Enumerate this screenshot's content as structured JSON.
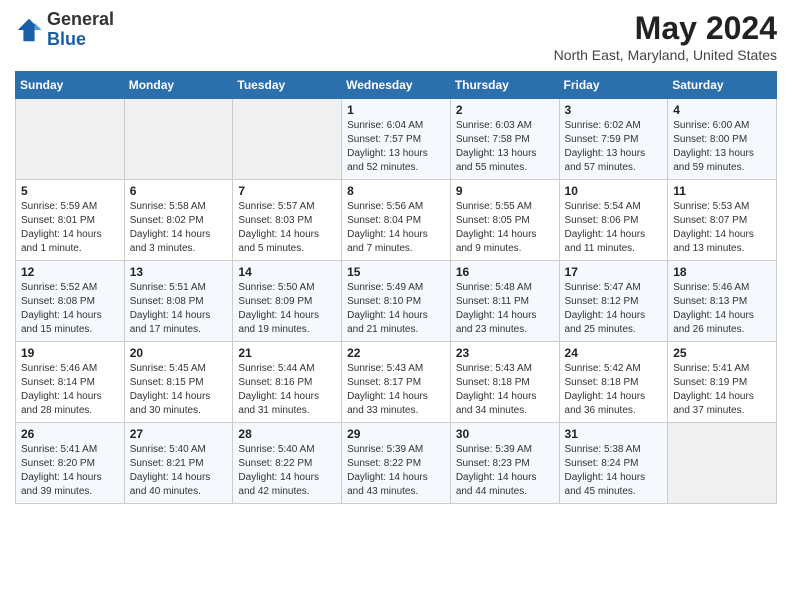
{
  "header": {
    "logo_general": "General",
    "logo_blue": "Blue",
    "month_year": "May 2024",
    "location": "North East, Maryland, United States"
  },
  "days_of_week": [
    "Sunday",
    "Monday",
    "Tuesday",
    "Wednesday",
    "Thursday",
    "Friday",
    "Saturday"
  ],
  "weeks": [
    [
      {
        "day": "",
        "info": ""
      },
      {
        "day": "",
        "info": ""
      },
      {
        "day": "",
        "info": ""
      },
      {
        "day": "1",
        "info": "Sunrise: 6:04 AM\nSunset: 7:57 PM\nDaylight: 13 hours\nand 52 minutes."
      },
      {
        "day": "2",
        "info": "Sunrise: 6:03 AM\nSunset: 7:58 PM\nDaylight: 13 hours\nand 55 minutes."
      },
      {
        "day": "3",
        "info": "Sunrise: 6:02 AM\nSunset: 7:59 PM\nDaylight: 13 hours\nand 57 minutes."
      },
      {
        "day": "4",
        "info": "Sunrise: 6:00 AM\nSunset: 8:00 PM\nDaylight: 13 hours\nand 59 minutes."
      }
    ],
    [
      {
        "day": "5",
        "info": "Sunrise: 5:59 AM\nSunset: 8:01 PM\nDaylight: 14 hours\nand 1 minute."
      },
      {
        "day": "6",
        "info": "Sunrise: 5:58 AM\nSunset: 8:02 PM\nDaylight: 14 hours\nand 3 minutes."
      },
      {
        "day": "7",
        "info": "Sunrise: 5:57 AM\nSunset: 8:03 PM\nDaylight: 14 hours\nand 5 minutes."
      },
      {
        "day": "8",
        "info": "Sunrise: 5:56 AM\nSunset: 8:04 PM\nDaylight: 14 hours\nand 7 minutes."
      },
      {
        "day": "9",
        "info": "Sunrise: 5:55 AM\nSunset: 8:05 PM\nDaylight: 14 hours\nand 9 minutes."
      },
      {
        "day": "10",
        "info": "Sunrise: 5:54 AM\nSunset: 8:06 PM\nDaylight: 14 hours\nand 11 minutes."
      },
      {
        "day": "11",
        "info": "Sunrise: 5:53 AM\nSunset: 8:07 PM\nDaylight: 14 hours\nand 13 minutes."
      }
    ],
    [
      {
        "day": "12",
        "info": "Sunrise: 5:52 AM\nSunset: 8:08 PM\nDaylight: 14 hours\nand 15 minutes."
      },
      {
        "day": "13",
        "info": "Sunrise: 5:51 AM\nSunset: 8:08 PM\nDaylight: 14 hours\nand 17 minutes."
      },
      {
        "day": "14",
        "info": "Sunrise: 5:50 AM\nSunset: 8:09 PM\nDaylight: 14 hours\nand 19 minutes."
      },
      {
        "day": "15",
        "info": "Sunrise: 5:49 AM\nSunset: 8:10 PM\nDaylight: 14 hours\nand 21 minutes."
      },
      {
        "day": "16",
        "info": "Sunrise: 5:48 AM\nSunset: 8:11 PM\nDaylight: 14 hours\nand 23 minutes."
      },
      {
        "day": "17",
        "info": "Sunrise: 5:47 AM\nSunset: 8:12 PM\nDaylight: 14 hours\nand 25 minutes."
      },
      {
        "day": "18",
        "info": "Sunrise: 5:46 AM\nSunset: 8:13 PM\nDaylight: 14 hours\nand 26 minutes."
      }
    ],
    [
      {
        "day": "19",
        "info": "Sunrise: 5:46 AM\nSunset: 8:14 PM\nDaylight: 14 hours\nand 28 minutes."
      },
      {
        "day": "20",
        "info": "Sunrise: 5:45 AM\nSunset: 8:15 PM\nDaylight: 14 hours\nand 30 minutes."
      },
      {
        "day": "21",
        "info": "Sunrise: 5:44 AM\nSunset: 8:16 PM\nDaylight: 14 hours\nand 31 minutes."
      },
      {
        "day": "22",
        "info": "Sunrise: 5:43 AM\nSunset: 8:17 PM\nDaylight: 14 hours\nand 33 minutes."
      },
      {
        "day": "23",
        "info": "Sunrise: 5:43 AM\nSunset: 8:18 PM\nDaylight: 14 hours\nand 34 minutes."
      },
      {
        "day": "24",
        "info": "Sunrise: 5:42 AM\nSunset: 8:18 PM\nDaylight: 14 hours\nand 36 minutes."
      },
      {
        "day": "25",
        "info": "Sunrise: 5:41 AM\nSunset: 8:19 PM\nDaylight: 14 hours\nand 37 minutes."
      }
    ],
    [
      {
        "day": "26",
        "info": "Sunrise: 5:41 AM\nSunset: 8:20 PM\nDaylight: 14 hours\nand 39 minutes."
      },
      {
        "day": "27",
        "info": "Sunrise: 5:40 AM\nSunset: 8:21 PM\nDaylight: 14 hours\nand 40 minutes."
      },
      {
        "day": "28",
        "info": "Sunrise: 5:40 AM\nSunset: 8:22 PM\nDaylight: 14 hours\nand 42 minutes."
      },
      {
        "day": "29",
        "info": "Sunrise: 5:39 AM\nSunset: 8:22 PM\nDaylight: 14 hours\nand 43 minutes."
      },
      {
        "day": "30",
        "info": "Sunrise: 5:39 AM\nSunset: 8:23 PM\nDaylight: 14 hours\nand 44 minutes."
      },
      {
        "day": "31",
        "info": "Sunrise: 5:38 AM\nSunset: 8:24 PM\nDaylight: 14 hours\nand 45 minutes."
      },
      {
        "day": "",
        "info": ""
      }
    ]
  ]
}
